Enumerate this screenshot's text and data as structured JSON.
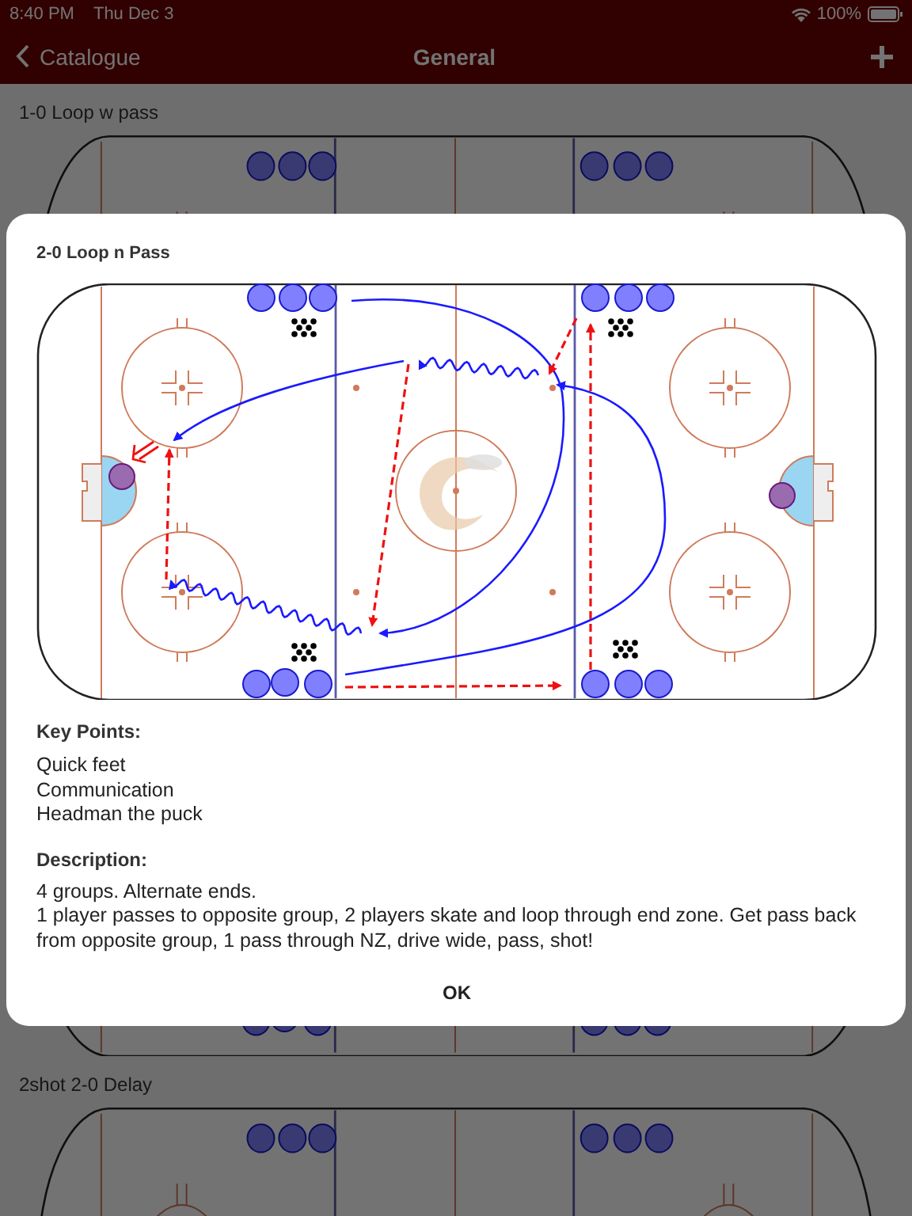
{
  "status_bar": {
    "time": "8:40 PM",
    "date": "Thu Dec 3",
    "battery": "100%"
  },
  "nav": {
    "back": "Catalogue",
    "title": "General"
  },
  "drills": [
    {
      "title": "1-0 Loop w pass"
    },
    {
      "title": "2shot 2-0 Delay"
    }
  ],
  "dialog": {
    "title": "2-0 Loop n Pass",
    "key_points_heading": "Key Points:",
    "key_points": [
      "Quick feet",
      "Communication",
      "Headman the puck"
    ],
    "description_heading": "Description:",
    "description": [
      "4 groups. Alternate ends.",
      "1 player passes to opposite group, 2 players skate and loop through end zone. Get pass back from opposite group, 1 pass through NZ, drive wide, pass, shot!"
    ],
    "button": "OK"
  }
}
